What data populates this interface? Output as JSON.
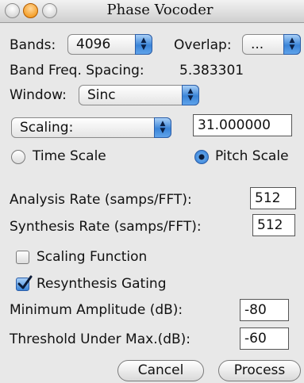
{
  "window": {
    "title": "Phase Vocoder"
  },
  "bands": {
    "label": "Bands:",
    "value": "4096"
  },
  "overlap": {
    "label": "Overlap:",
    "value": "..."
  },
  "band_spacing": {
    "label": "Band Freq. Spacing:",
    "value": "5.383301"
  },
  "window_type": {
    "label": "Window:",
    "value": "Sinc"
  },
  "scaling": {
    "mode": "Scaling:",
    "value": "31.000000"
  },
  "scale_options": {
    "time_label": "Time Scale",
    "pitch_label": "Pitch Scale",
    "selected": "Pitch Scale"
  },
  "analysis_rate": {
    "label": "Analysis Rate (samps/FFT):",
    "value": "512"
  },
  "synthesis_rate": {
    "label": "Synthesis Rate (samps/FFT):",
    "value": "512"
  },
  "scaling_function": {
    "label": "Scaling Function",
    "checked": false
  },
  "resynthesis_gating": {
    "label": "Resynthesis Gating",
    "checked": true
  },
  "min_amplitude": {
    "label": "Minimum Amplitude (dB):",
    "value": "-80"
  },
  "threshold": {
    "label": "Threshold Under Max.(dB):",
    "value": "-60"
  },
  "buttons": {
    "cancel": "Cancel",
    "process": "Process"
  },
  "icons": {
    "popup_arrow": "up-down-arrows-icon",
    "check": "checkmark-icon"
  }
}
